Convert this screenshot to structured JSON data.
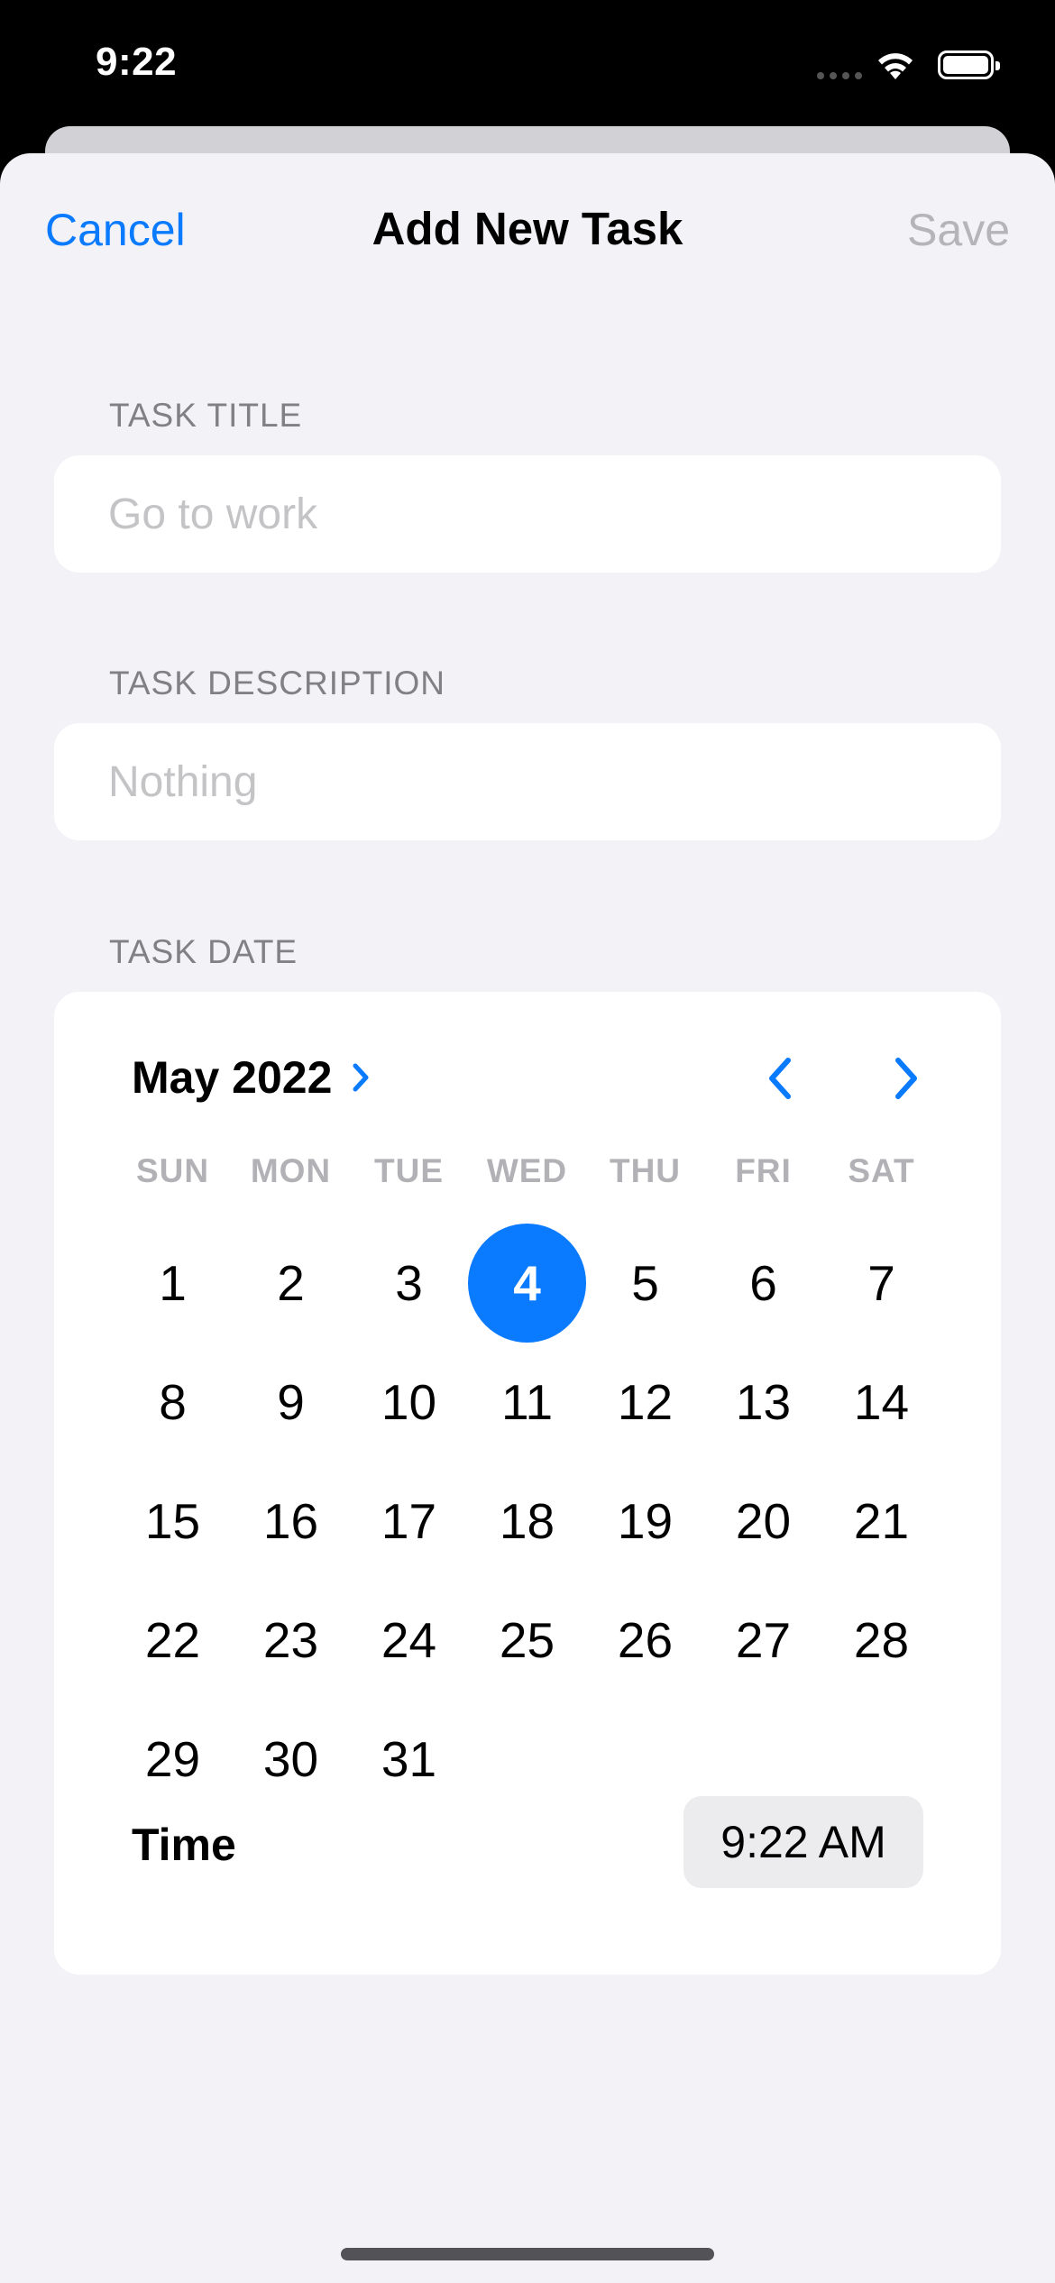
{
  "status_bar": {
    "time": "9:22"
  },
  "nav": {
    "cancel_label": "Cancel",
    "title": "Add New Task",
    "save_label": "Save"
  },
  "form": {
    "title_section": {
      "header": "TASK TITLE",
      "placeholder": "Go to work",
      "value": ""
    },
    "description_section": {
      "header": "TASK DESCRIPTION",
      "placeholder": "Nothing",
      "value": ""
    },
    "date_section": {
      "header": "TASK DATE"
    }
  },
  "calendar": {
    "month_label": "May 2022",
    "weekdays": [
      "SUN",
      "MON",
      "TUE",
      "WED",
      "THU",
      "FRI",
      "SAT"
    ],
    "first_weekday_index": 0,
    "days_in_month": 31,
    "selected_day": 4,
    "accent_color": "#0a7aff"
  },
  "time": {
    "label": "Time",
    "value": "9:22 AM"
  }
}
